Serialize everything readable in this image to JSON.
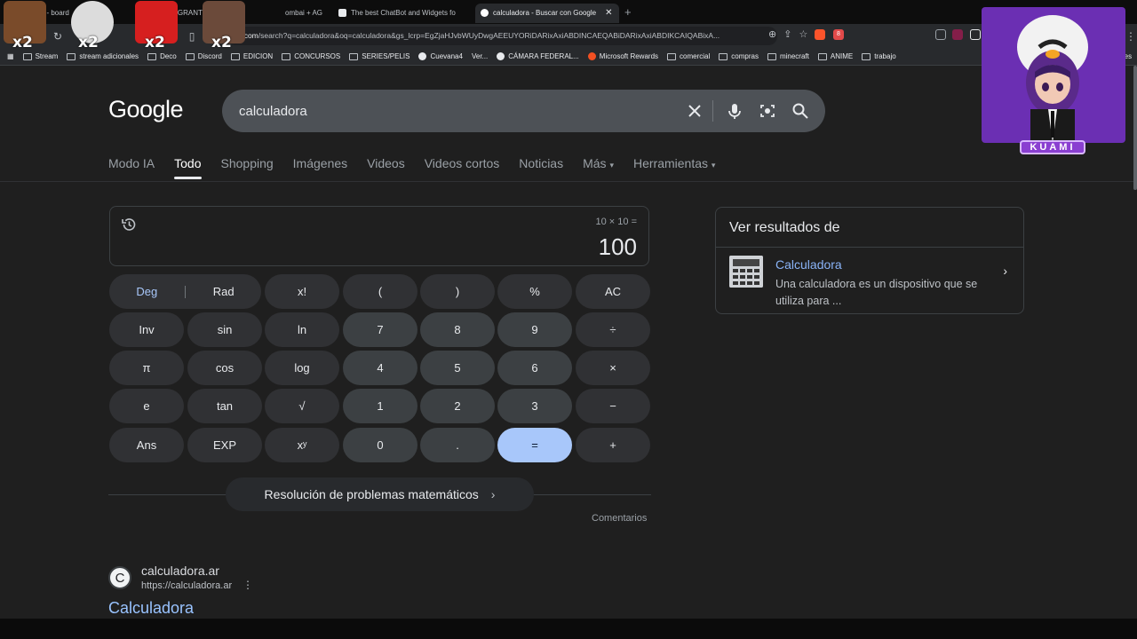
{
  "browser": {
    "tabs": [
      {
        "label": "ci Points - board"
      },
      {
        "label": "MIGRANTE"
      },
      {
        "label": "ombai + AG"
      },
      {
        "label": "The best ChatBot and Widgets fo"
      },
      {
        "label": "calculadora - Buscar con Google",
        "active": true
      }
    ],
    "url_prefix": "gle.com",
    "url_rest": "/search?q=calculadora&oq=calculadora&gs_lcrp=EgZjaHJvbWUyDwgAEEUYORiDARixAxiABDINCAEQABiDARixAxiABDIKCAIQABixA...",
    "notification_count": "8",
    "bookmarks": [
      "Stream",
      "stream adicionales",
      "Deco",
      "Discord",
      "EDICION",
      "CONCURSOS",
      "SERIES/PELIS",
      "Cuevana4",
      "Ver...",
      "CÁMARA FEDERAL...",
      "Microsoft Rewards",
      "comercial",
      "compras",
      "minecraft",
      "ANIME",
      "trabajo"
    ],
    "bookmarks_more": "res"
  },
  "google": {
    "logo": "Google",
    "query": "calculadora",
    "tabs": [
      "Modo IA",
      "Todo",
      "Shopping",
      "Imágenes",
      "Videos",
      "Videos cortos",
      "Noticias",
      "Más",
      "Herramientas"
    ]
  },
  "calculator": {
    "expression": "10 × 10 =",
    "result": "100",
    "deg_label": "Deg",
    "rad_label": "Rad",
    "keys": [
      [
        "x!",
        "(",
        ")",
        "%",
        "AC"
      ],
      [
        "Inv",
        "sin",
        "ln",
        "7",
        "8",
        "9",
        "÷"
      ],
      [
        "π",
        "cos",
        "log",
        "4",
        "5",
        "6",
        "×"
      ],
      [
        "e",
        "tan",
        "√",
        "1",
        "2",
        "3",
        "−"
      ],
      [
        "Ans",
        "EXP",
        "xʸ",
        "0",
        ".",
        "=",
        "+"
      ]
    ],
    "math_help": "Resolución de problemas matemáticos",
    "feedback": "Comentarios"
  },
  "result": {
    "site_icon_letter": "C",
    "site_name": "calculadora.ar",
    "site_url": "https://calculadora.ar",
    "title": "Calculadora"
  },
  "side_panel": {
    "header": "Ver resultados de",
    "title": "Calculadora",
    "description": "Una calculadora es un dispositivo que se utiliza para ..."
  },
  "overlay": {
    "emote_badges": [
      "x2",
      "x2",
      "x2",
      "x2"
    ],
    "streamer_name": "KUAMI"
  },
  "colors": {
    "accent": "#a8c7fa",
    "link": "#8ab4f8",
    "bg": "#1f1f1f"
  }
}
